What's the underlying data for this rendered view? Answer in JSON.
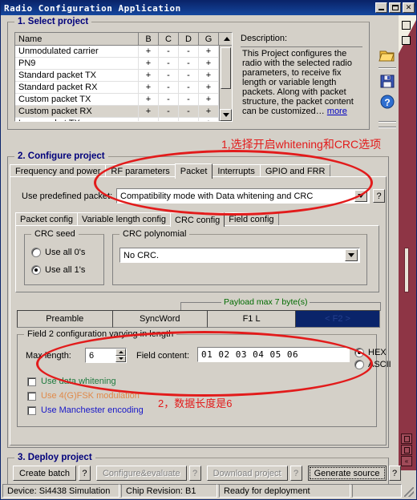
{
  "window": {
    "title": "Radio Configuration Application",
    "buttons": {
      "minimize": "minimize-icon",
      "maximize": "maximize-icon",
      "close": "✕"
    }
  },
  "section1": {
    "legend": "1. Select project",
    "table": {
      "columns": [
        "Name",
        "B",
        "C",
        "D",
        "G"
      ],
      "rows": [
        {
          "name": "Unmodulated carrier",
          "b": "+",
          "c": "-",
          "d": "-",
          "g": "+",
          "selected": false
        },
        {
          "name": "PN9",
          "b": "+",
          "c": "-",
          "d": "-",
          "g": "+",
          "selected": false
        },
        {
          "name": "Standard packet TX",
          "b": "+",
          "c": "-",
          "d": "-",
          "g": "+",
          "selected": false
        },
        {
          "name": "Standard packet RX",
          "b": "+",
          "c": "-",
          "d": "-",
          "g": "+",
          "selected": false
        },
        {
          "name": "Custom packet TX",
          "b": "+",
          "c": "-",
          "d": "-",
          "g": "+",
          "selected": false
        },
        {
          "name": "Custom packet RX",
          "b": "+",
          "c": "-",
          "d": "-",
          "g": "+",
          "selected": true
        },
        {
          "name": "Long packet TX",
          "b": "-",
          "c": "-",
          "d": "-",
          "g": "+",
          "selected": false
        }
      ]
    },
    "description": {
      "label": "Description:",
      "text": "This Project configures the radio with the selected radio parameters, to receive fix length or variable length packets. Along with packet structure, the packet content can be customized… ",
      "more_link": "more"
    },
    "icons": {
      "open": "open-folder-icon",
      "save": "save-disk-icon",
      "help": "help-question-icon"
    }
  },
  "section2": {
    "legend": "2. Configure project",
    "outer_tabs": [
      {
        "label": "Frequency and power",
        "active": false
      },
      {
        "label": "RF parameters",
        "active": false
      },
      {
        "label": "Packet",
        "active": true
      },
      {
        "label": "Interrupts",
        "active": false
      },
      {
        "label": "GPIO and FRR",
        "active": false
      }
    ],
    "predefined": {
      "label": "Use predefined packet:",
      "value": "Compatibility mode with Data whitening and CRC",
      "help_label": "?"
    },
    "inner_tabs": [
      {
        "label": "Packet config",
        "active": false
      },
      {
        "label": "Variable length config",
        "active": false
      },
      {
        "label": "CRC config",
        "active": true
      },
      {
        "label": "Field config",
        "active": false
      }
    ],
    "crc_seed": {
      "legend": "CRC seed",
      "options": [
        {
          "label": "Use all 0's",
          "selected": false
        },
        {
          "label": "Use all 1's",
          "selected": true
        }
      ]
    },
    "crc_polynomial": {
      "legend": "CRC polynomial",
      "value": "No CRC."
    },
    "payload": {
      "legend": "Payload max 7 byte(s)",
      "color": "#006b00"
    },
    "field_bar": [
      {
        "label": "Preamble",
        "selected": false
      },
      {
        "label": "SyncWord",
        "selected": false
      },
      {
        "label": "F1 L",
        "selected": false
      },
      {
        "label": "< F2 >",
        "selected": true
      }
    ],
    "field2": {
      "legend": "Field 2 configuration varying in length",
      "max_length_label": "Max length:",
      "max_length_value": "6",
      "field_content_label": "Field content:",
      "field_content_value": "01 02 03 04 05 06",
      "format_options": [
        {
          "label": "HEX",
          "selected": true
        },
        {
          "label": "ASCII",
          "selected": false
        }
      ],
      "checkboxes": [
        {
          "label": "Use data whitening",
          "checked": false,
          "style": "lbl-green"
        },
        {
          "label": "Use 4(G)FSK modulation",
          "checked": false,
          "style": "lbl-orange"
        },
        {
          "label": "Use Manchester encoding",
          "checked": false,
          "style": "lbl-blue"
        }
      ]
    }
  },
  "section3": {
    "legend": "3. Deploy project",
    "buttons": [
      {
        "label": "Create batch",
        "disabled": false,
        "focus": false,
        "help": "?"
      },
      {
        "label": "Configure&evaluate",
        "disabled": true,
        "focus": false,
        "help": "?"
      },
      {
        "label": "Download project",
        "disabled": true,
        "focus": false,
        "help": "?"
      },
      {
        "label": "Generate source",
        "disabled": false,
        "focus": true,
        "help": "?"
      }
    ]
  },
  "statusbar": {
    "device": "Device: Si4438  Simulation",
    "chip_revision": "Chip Revision: B1",
    "state": "Ready for deployment",
    "extra": ""
  },
  "annotations": [
    {
      "id": "anno1",
      "text": "1,选择开启whitening和CRC选项",
      "color": "#e21b1b"
    },
    {
      "id": "anno2",
      "text": "2，数据长度是6",
      "color": "#e21b1b"
    }
  ],
  "rail": {
    "buttons": [
      "restore-rail-button",
      "collapse-rail-button",
      "scroll-left-rail-button"
    ]
  }
}
